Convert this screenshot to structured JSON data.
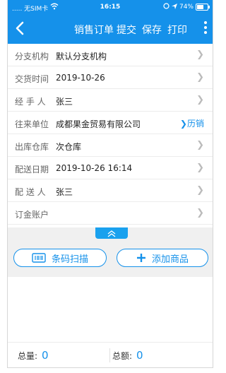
{
  "status_bar": {
    "carrier": "..... 无SIM卡",
    "time": "16:15",
    "battery_text": "74%",
    "battery_level": 0.74
  },
  "nav": {
    "title": "销售订单",
    "submit": "提交",
    "save": "保存",
    "print": "打印"
  },
  "rows": [
    {
      "label": "分支机构",
      "value": "默认分支机构"
    },
    {
      "label": "交货时间",
      "value": "2019-10-26"
    },
    {
      "label": "经 手 人",
      "value": "张三"
    },
    {
      "label": "往来单位",
      "value": "成都果金贸易有限公司",
      "extra": "历销"
    },
    {
      "label": "出库仓库",
      "value": "次仓库"
    },
    {
      "label": "配送日期",
      "value": "2019-10-26 16:14"
    },
    {
      "label": "配 送 人",
      "value": "张三"
    },
    {
      "label": "订金账户",
      "value": ""
    }
  ],
  "buttons": {
    "scan": "条码扫描",
    "add": "添加商品"
  },
  "summary": {
    "qty_label": "总量:",
    "qty_value": "0",
    "amount_label": "总额:",
    "amount_value": "0"
  },
  "colors": {
    "primary": "#1591ea",
    "divider": "#ececec",
    "panel": "#f0f0f0"
  }
}
